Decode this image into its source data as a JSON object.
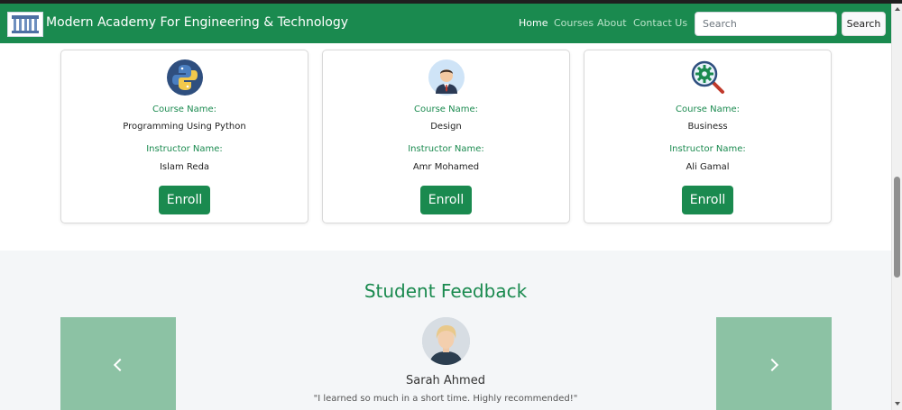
{
  "navbar": {
    "brand": "Modern Academy For Engineering & Technology",
    "links": [
      "Home",
      "Courses",
      "About",
      "Contact Us"
    ],
    "search_placeholder": "Search",
    "search_button": "Search"
  },
  "courses": [
    {
      "course_label": "Course Name:",
      "course_name": "Programming Using Python",
      "instructor_label": "Instructor Name:",
      "instructor_name": "Islam Reda",
      "enroll": "Enroll",
      "icon": "python-logo-icon"
    },
    {
      "course_label": "Course Name:",
      "course_name": "Design",
      "instructor_label": "Instructor Name:",
      "instructor_name": "Amr Mohamed",
      "enroll": "Enroll",
      "icon": "businessman-avatar-icon"
    },
    {
      "course_label": "Course Name:",
      "course_name": "Business",
      "instructor_label": "Instructor Name:",
      "instructor_name": "Ali Gamal",
      "enroll": "Enroll",
      "icon": "gear-magnifier-icon"
    }
  ],
  "feedback": {
    "title": "Student Feedback",
    "name": "Sarah Ahmed",
    "quote": "\"I learned so much in a short time. Highly recommended!\""
  },
  "colors": {
    "brand_green": "#1a8a4f",
    "carousel_green": "#8cc2a4"
  }
}
